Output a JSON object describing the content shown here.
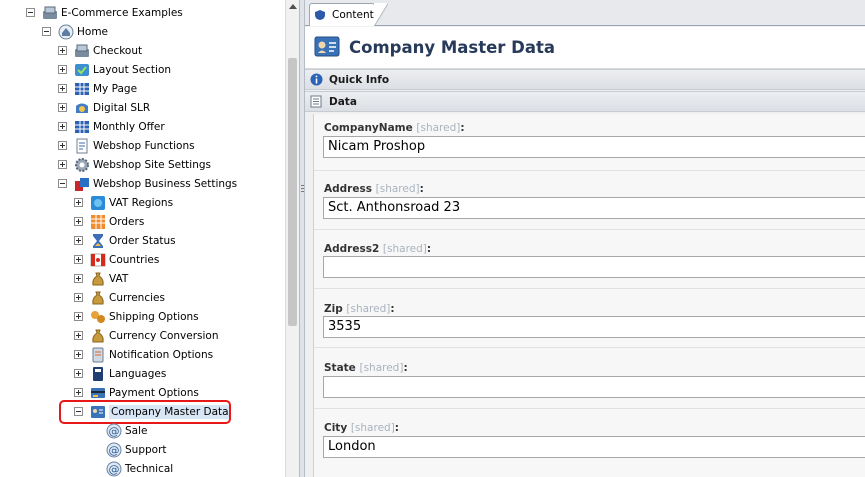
{
  "tree": {
    "root": "E-Commerce Examples",
    "home": "Home",
    "home_children": [
      "Checkout",
      "Layout Section",
      "My Page",
      "Digital SLR",
      "Monthly Offer",
      "Webshop Functions",
      "Webshop Site Settings",
      "Webshop Business Settings"
    ],
    "business_children": [
      "VAT Regions",
      "Orders",
      "Order Status",
      "Countries",
      "VAT",
      "Currencies",
      "Shipping Options",
      "Currency Conversion",
      "Notification Options",
      "Languages",
      "Payment Options",
      "Company Master Data"
    ],
    "company_children": [
      "Sale",
      "Support",
      "Technical"
    ]
  },
  "tab": {
    "label": "Content"
  },
  "page": {
    "title": "Company Master Data"
  },
  "sections": {
    "quick_info": "Quick Info",
    "data": "Data"
  },
  "shared_tag": "[shared]",
  "fields": [
    {
      "label": "CompanyName",
      "value": "Nicam Proshop"
    },
    {
      "label": "Address",
      "value": "Sct. Anthonsroad 23"
    },
    {
      "label": "Address2",
      "value": ""
    },
    {
      "label": "Zip",
      "value": "3535"
    },
    {
      "label": "State",
      "value": ""
    },
    {
      "label": "City",
      "value": "London"
    }
  ],
  "colors": {
    "title": "#283a5a",
    "highlight": "#e81818",
    "shared": "#a9b3bf"
  }
}
